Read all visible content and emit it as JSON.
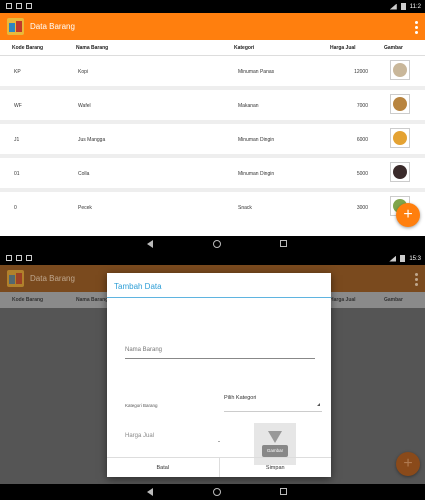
{
  "status": {
    "time_top": "11:2",
    "time_bottom": "15:3"
  },
  "app": {
    "title": "Data Barang",
    "accent": "#ff7f0e"
  },
  "table": {
    "headers": [
      "Kode Barang",
      "Nama Barang",
      "Kategori",
      "Harga Jual",
      "Gambar"
    ],
    "rows": [
      {
        "kode": "KP",
        "nama": "Kopi",
        "kategori": "Minuman Panas",
        "harga": "12000",
        "thumb": "#c9b79a"
      },
      {
        "kode": "WF",
        "nama": "Wafel",
        "kategori": "Makanan",
        "harga": "7000",
        "thumb": "#b8843f"
      },
      {
        "kode": "J1",
        "nama": "Jus Mangga",
        "kategori": "Minuman Dingin",
        "harga": "6000",
        "thumb": "#e4a232"
      },
      {
        "kode": "01",
        "nama": "Colla",
        "kategori": "Minuman Dingin",
        "harga": "5000",
        "thumb": "#3a2a2a"
      },
      {
        "kode": "0",
        "nama": "Pecek",
        "kategori": "Snack",
        "harga": "3000",
        "thumb": "#7fa54a"
      }
    ]
  },
  "fab": {
    "label": "+"
  },
  "dialog": {
    "title": "Tambah Data",
    "nama_placeholder": "Nama Barang",
    "kategori_label": "Kategori Barang",
    "kategori_value": "Pilih Kategori",
    "harga_label": "Harga Jual",
    "gambar_label": "Gambar",
    "cancel_label": "Batal",
    "save_label": "Simpan"
  }
}
